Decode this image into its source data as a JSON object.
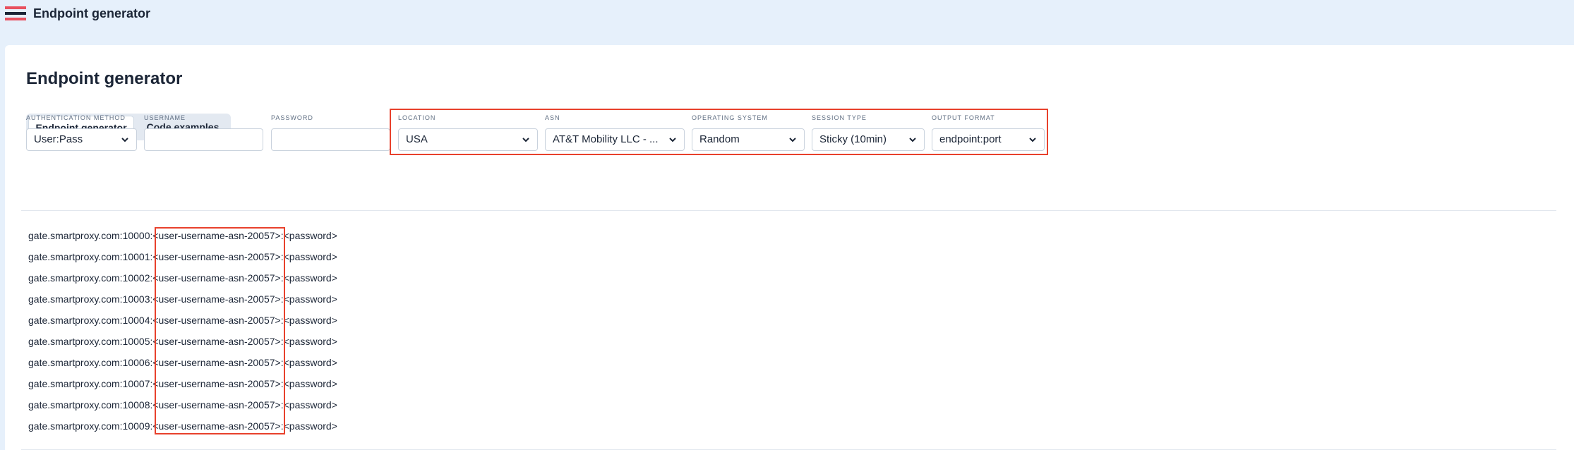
{
  "header": {
    "title": "Endpoint generator",
    "logo_colors": [
      "#e8515f",
      "#1b2536",
      "#e8515f"
    ]
  },
  "main": {
    "title": "Endpoint generator",
    "tabs": [
      {
        "label": "Endpoint generator",
        "active": true
      },
      {
        "label": "Code examples",
        "active": false
      }
    ],
    "fields": {
      "auth_method": {
        "label": "AUTHENTICATION METHOD",
        "value": "User:Pass"
      },
      "username": {
        "label": "USERNAME",
        "value": ""
      },
      "password": {
        "label": "PASSWORD",
        "value": ""
      },
      "location": {
        "label": "LOCATION",
        "value": "USA"
      },
      "asn": {
        "label": "ASN",
        "value": "AT&T Mobility LLC - ..."
      },
      "os": {
        "label": "OPERATING SYSTEM",
        "value": "Random"
      },
      "session": {
        "label": "SESSION TYPE",
        "value": "Sticky (10min)"
      },
      "output": {
        "label": "OUTPUT FORMAT",
        "value": "endpoint:port"
      }
    },
    "endpoints": [
      "gate.smartproxy.com:10000:<user-username-asn-20057>:<password>",
      "gate.smartproxy.com:10001:<user-username-asn-20057>:<password>",
      "gate.smartproxy.com:10002:<user-username-asn-20057>:<password>",
      "gate.smartproxy.com:10003:<user-username-asn-20057>:<password>",
      "gate.smartproxy.com:10004:<user-username-asn-20057>:<password>",
      "gate.smartproxy.com:10005:<user-username-asn-20057>:<password>",
      "gate.smartproxy.com:10006:<user-username-asn-20057>:<password>",
      "gate.smartproxy.com:10007:<user-username-asn-20057>:<password>",
      "gate.smartproxy.com:10008:<user-username-asn-20057>:<password>",
      "gate.smartproxy.com:10009:<user-username-asn-20057>:<password>"
    ]
  },
  "colors": {
    "highlight": "#e8412c",
    "page_bg": "#e6f0fb"
  },
  "icons": [
    "logo-icon",
    "chevron-down-icon"
  ]
}
